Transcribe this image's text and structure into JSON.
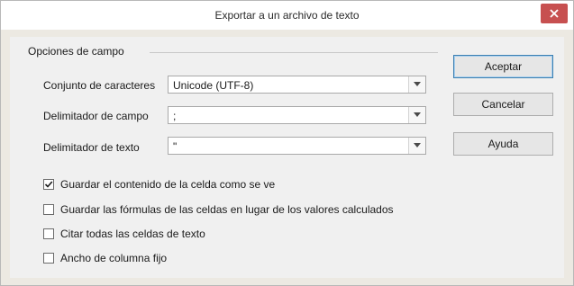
{
  "window": {
    "title": "Exportar a un archivo de texto",
    "close_icon": "close-icon",
    "close_color": "#c75050"
  },
  "field_options": {
    "group_label": "Opciones de campo",
    "charset": {
      "label": "Conjunto de caracteres",
      "value": "Unicode (UTF-8)"
    },
    "field_delimiter": {
      "label": "Delimitador de campo",
      "value": ";"
    },
    "text_delimiter": {
      "label": "Delimitador de texto",
      "value": "\""
    }
  },
  "checkboxes": [
    {
      "label": "Guardar el contenido de la celda como se ve",
      "checked": true
    },
    {
      "label": "Guardar las fórmulas de las celdas en lugar de los valores calculados",
      "checked": false
    },
    {
      "label": "Citar todas las celdas de texto",
      "checked": false
    },
    {
      "label": "Ancho de columna fijo",
      "checked": false
    }
  ],
  "buttons": {
    "ok": "Aceptar",
    "cancel": "Cancelar",
    "help": "Ayuda"
  }
}
